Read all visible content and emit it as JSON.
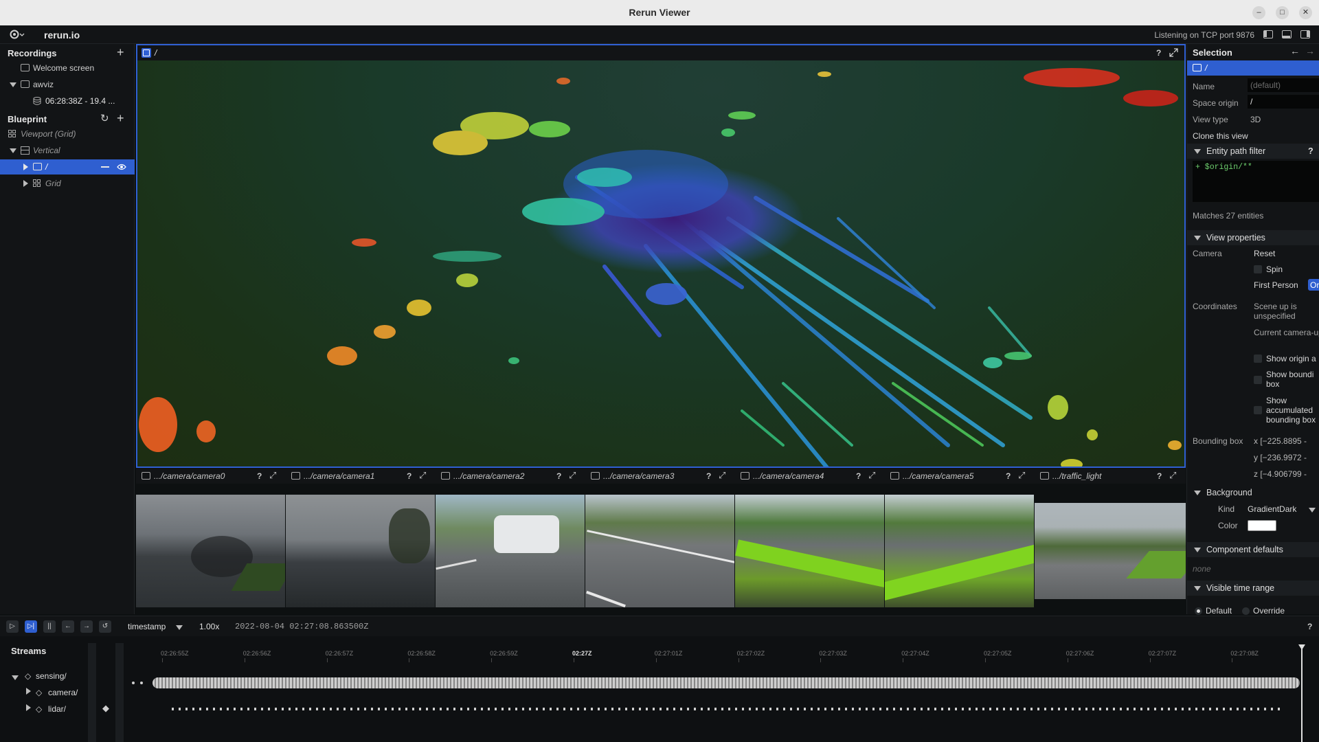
{
  "window": {
    "title": "Rerun Viewer",
    "buttons": [
      "–",
      "□",
      "✕"
    ]
  },
  "topbar": {
    "brand": "rerun.io",
    "status": "Listening on TCP port 9876"
  },
  "recordings": {
    "title": "Recordings",
    "welcome": "Welcome screen",
    "app": "awviz",
    "recording": "06:28:38Z - 19.4 ..."
  },
  "blueprint": {
    "title": "Blueprint",
    "viewport": "Viewport (Grid)",
    "vertical": "Vertical",
    "root": "/",
    "grid": "Grid"
  },
  "view3d": {
    "path": "/",
    "help": "?"
  },
  "cameras": [
    {
      "label": ".../camera/camera0"
    },
    {
      "label": ".../camera/camera1"
    },
    {
      "label": ".../camera/camera2"
    },
    {
      "label": ".../camera/camera3"
    },
    {
      "label": ".../camera/camera4"
    },
    {
      "label": ".../camera/camera5"
    },
    {
      "label": ".../traffic_light"
    }
  ],
  "selection": {
    "title": "Selection",
    "item": "/",
    "name_label": "Name",
    "name_value": "(default)",
    "origin_label": "Space origin",
    "origin_value": "/",
    "viewtype_label": "View type",
    "viewtype_value": "3D",
    "clone": "Clone this view",
    "filter_head": "Entity path filter",
    "filter_value": "+ $origin/**",
    "matches": "Matches 27 entities",
    "viewprops_head": "View properties",
    "camera_label": "Camera",
    "reset": "Reset",
    "spin": "Spin",
    "first_person": "First Person",
    "first_person_value": "Or",
    "coords_label": "Coordinates",
    "scene_up": "Scene up is unspecified",
    "camera_up": "Current camera-up-axis is +Z",
    "show_origin": "Show origin a",
    "show_bbox": "Show boundi box",
    "show_accum": "Show accumulated bounding box",
    "bbox_label": "Bounding box",
    "bbox_x": "x [−225.8895 -",
    "bbox_y": "y [−236.9972 -",
    "bbox_z": "z [−4.906799 -",
    "background_head": "Background",
    "kind_label": "Kind",
    "kind_value": "GradientDark",
    "color_label": "Color",
    "compdef_head": "Component defaults",
    "compdef_value": "none",
    "timerange_head": "Visible time range",
    "default_label": "Default",
    "override_label": "Override"
  },
  "timeline": {
    "timeline_name": "timestamp",
    "speed": "1.00x",
    "current_time": "2022-08-04 02:27:08.863500Z",
    "streams_title": "Streams",
    "streams": [
      "sensing/",
      "camera/",
      "lidar/"
    ],
    "ticks": [
      "02:26:55Z",
      "02:26:56Z",
      "02:26:57Z",
      "02:26:58Z",
      "02:26:59Z",
      "02:27Z",
      "02:27:01Z",
      "02:27:02Z",
      "02:27:03Z",
      "02:27:04Z",
      "02:27:05Z",
      "02:27:06Z",
      "02:27:07Z",
      "02:27:08Z"
    ],
    "help": "?"
  },
  "colors": {
    "accent": "#3060d4",
    "panel": "#121416",
    "selected": "#2f5fd0"
  }
}
